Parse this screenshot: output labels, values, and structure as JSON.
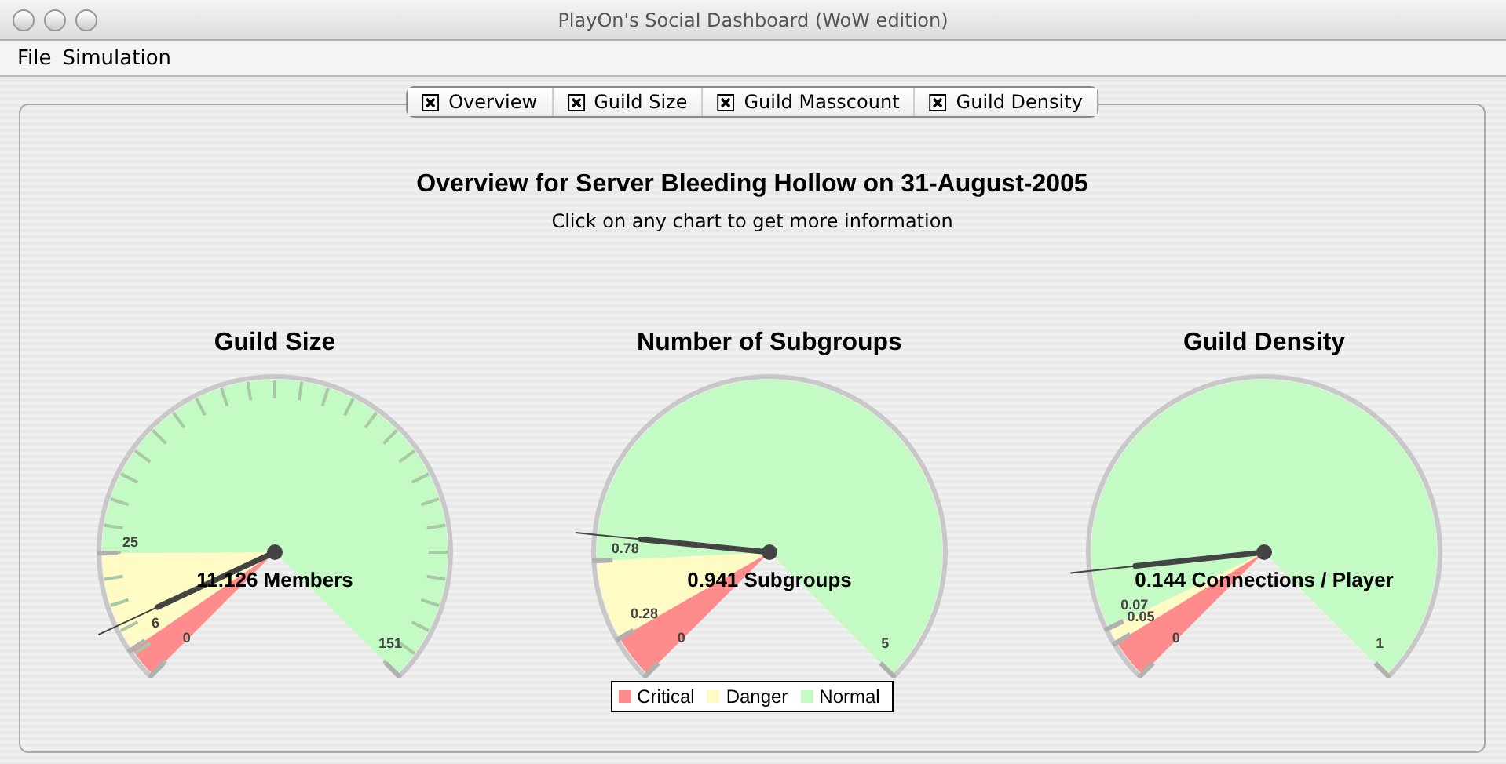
{
  "window": {
    "title": "PlayOn's Social Dashboard (WoW edition)"
  },
  "menu": [
    "File",
    "Simulation"
  ],
  "tabs": [
    {
      "label": "Overview"
    },
    {
      "label": "Guild Size"
    },
    {
      "label": "Guild Masscount"
    },
    {
      "label": "Guild Density"
    }
  ],
  "heading": "Overview for Server Bleeding Hollow on 31-August-2005",
  "subheading": "Click on any chart to get more information",
  "gauges": [
    {
      "title": "Guild Size",
      "reading": "11.126 Members",
      "start_label": "0",
      "bands": [
        {
          "kind": "critical",
          "end_label": "6"
        },
        {
          "kind": "danger",
          "end_label": "25"
        },
        {
          "kind": "normal",
          "end_label": "151"
        }
      ]
    },
    {
      "title": "Number of Subgroups",
      "reading": "0.941 Subgroups",
      "start_label": "0",
      "bands": [
        {
          "kind": "critical",
          "end_label": "0.28"
        },
        {
          "kind": "danger",
          "end_label": "0.78"
        },
        {
          "kind": "normal",
          "end_label": "5"
        }
      ]
    },
    {
      "title": "Guild Density",
      "reading": "0.144 Connections / Player",
      "start_label": "0",
      "bands": [
        {
          "kind": "critical",
          "end_label": "0.05"
        },
        {
          "kind": "danger",
          "end_label": "0.07"
        },
        {
          "kind": "normal",
          "end_label": "1"
        }
      ]
    }
  ],
  "legend": [
    {
      "kind": "critical",
      "label": "Critical",
      "color": "#ff8c8c"
    },
    {
      "kind": "danger",
      "label": "Danger",
      "color": "#fffbc4"
    },
    {
      "kind": "normal",
      "label": "Normal",
      "color": "#c4fbc4"
    }
  ]
}
